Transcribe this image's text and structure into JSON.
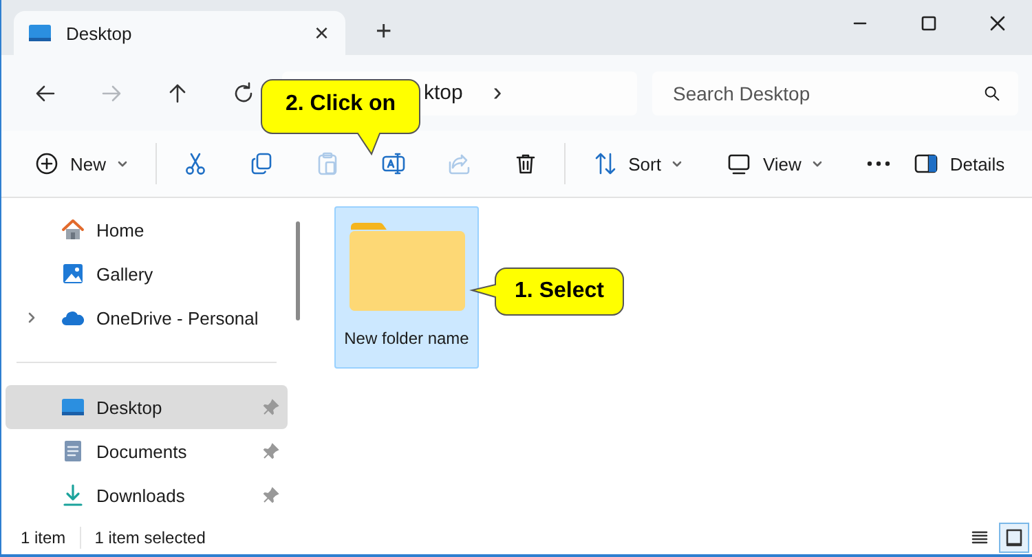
{
  "window": {
    "tab_title": "Desktop",
    "tab_close": "×",
    "new_tab": "+"
  },
  "address_bar": {
    "path": "ktop",
    "chevron": "›"
  },
  "search": {
    "placeholder": "Search Desktop"
  },
  "command_groups": [
    [
      {
        "kind": "new",
        "label": "New",
        "disabled": false
      }
    ],
    [
      {
        "kind": "cut",
        "disabled": false
      },
      {
        "kind": "copy",
        "disabled": false
      },
      {
        "kind": "paste",
        "disabled": true
      },
      {
        "kind": "rename",
        "disabled": false
      },
      {
        "kind": "share",
        "disabled": true
      },
      {
        "kind": "delete",
        "disabled": false
      }
    ],
    [
      {
        "kind": "sort",
        "label": "Sort",
        "disabled": false
      },
      {
        "kind": "view",
        "label": "View",
        "disabled": false
      },
      {
        "kind": "more",
        "disabled": false
      }
    ]
  ],
  "details_button": {
    "label": "Details"
  },
  "sidebar": {
    "groups": [
      [
        {
          "kind": "home",
          "label": "Home",
          "selected": false
        },
        {
          "kind": "gallery",
          "label": "Gallery",
          "selected": false
        },
        {
          "kind": "cloud",
          "label": "OneDrive - Personal",
          "selected": false,
          "expanded": false
        }
      ],
      [
        {
          "kind": "desktop",
          "label": "Desktop",
          "selected": true,
          "pinned": true
        },
        {
          "kind": "documents",
          "label": "Documents",
          "selected": false,
          "pinned": true
        },
        {
          "kind": "downloads",
          "label": "Downloads",
          "selected": false,
          "pinned": true
        }
      ]
    ]
  },
  "files": [
    {
      "name": "New folder name",
      "selected": true
    }
  ],
  "status_bar": {
    "item_count": "1 item",
    "selection": "1 item selected"
  },
  "view_modes": [
    {
      "kind": "details",
      "selected": false
    },
    {
      "kind": "large-icons",
      "selected": true
    }
  ],
  "callouts": [
    {
      "text": "2. Click on"
    },
    {
      "text": "1. Select"
    }
  ]
}
